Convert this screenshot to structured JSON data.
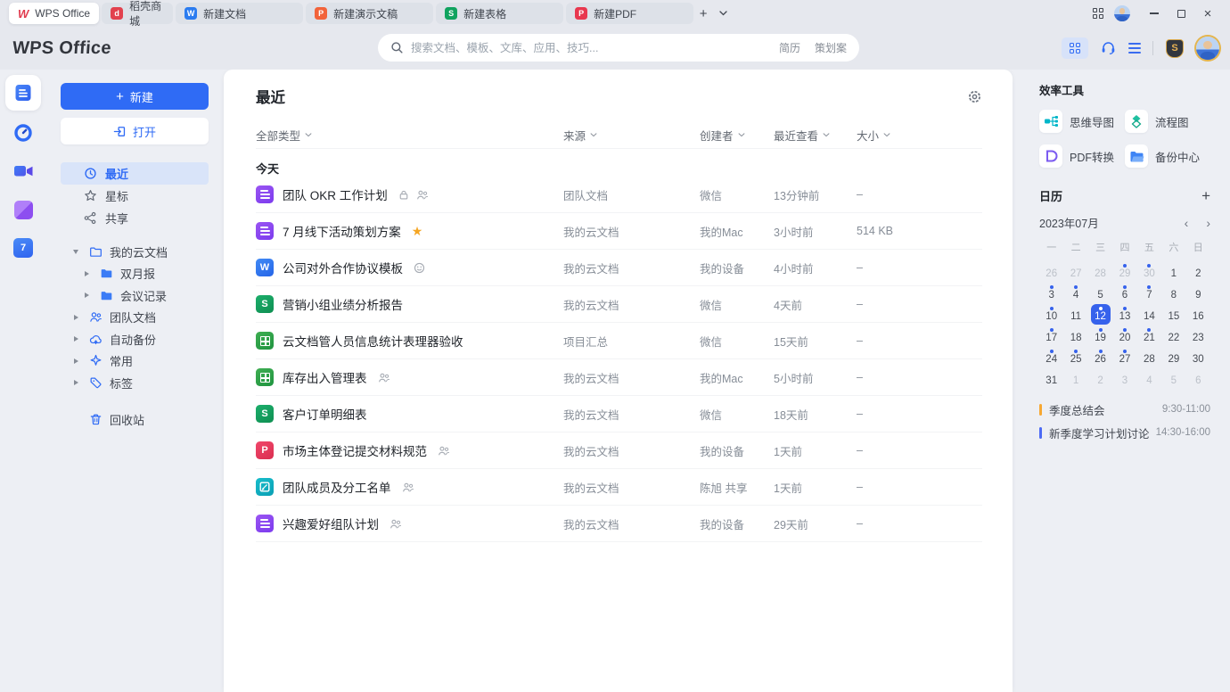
{
  "colors": {
    "accent": "#2f6bf5",
    "star": "#f5a623"
  },
  "titlebar": {
    "tabs": [
      {
        "label": "WPS Office",
        "icon": "wps-logo-icon",
        "active": true
      },
      {
        "label": "稻壳商城",
        "icon": "docer-icon",
        "color": "#e2414e",
        "letter": "d",
        "wide": false
      },
      {
        "label": "新建文档",
        "icon": "writer-icon",
        "color": "#2b7cf0",
        "letter": "W",
        "wide": true
      },
      {
        "label": "新建演示文稿",
        "icon": "presentation-icon",
        "color": "#f2633a",
        "letter": "P",
        "wide": true
      },
      {
        "label": "新建表格",
        "icon": "spreadsheet-icon",
        "color": "#10a35f",
        "letter": "S",
        "wide": true
      },
      {
        "label": "新建PDF",
        "icon": "pdf-icon",
        "color": "#e8384f",
        "letter": "P",
        "wide": true
      }
    ],
    "new_tab_label": "+"
  },
  "header": {
    "logo": "WPS Office",
    "search": {
      "placeholder": "搜索文档、模板、文库、应用、技巧...",
      "hotwords": [
        "简历",
        "策划案"
      ]
    },
    "member_badge": "S"
  },
  "rail": [
    {
      "name": "docs-home",
      "icon": "docs-icon",
      "active": true
    },
    {
      "name": "schedule",
      "icon": "clock-ring-icon",
      "active": false
    },
    {
      "name": "meeting",
      "icon": "video-camera-icon",
      "active": false
    },
    {
      "name": "apps",
      "icon": "apps-cube-icon",
      "active": false
    },
    {
      "name": "calendar",
      "icon": "calendar-7-icon",
      "label": "7",
      "active": false
    }
  ],
  "sidebar": {
    "new_button": "新建",
    "open_button": "打开",
    "nav": [
      {
        "label": "最近",
        "icon": "clock-icon",
        "active": true
      },
      {
        "label": "星标",
        "icon": "star-outline-icon",
        "active": false
      },
      {
        "label": "共享",
        "icon": "share-nodes-icon",
        "active": false
      }
    ],
    "tree": [
      {
        "label": "我的云文档",
        "icon": "folder-outline-icon",
        "caret": "down",
        "level": 0
      },
      {
        "label": "双月报",
        "icon": "folder-filled-icon",
        "caret": "right",
        "level": 1
      },
      {
        "label": "会议记录",
        "icon": "folder-filled-icon",
        "caret": "right",
        "level": 1
      },
      {
        "label": "团队文档",
        "icon": "team-icon",
        "caret": "right",
        "level": 0
      },
      {
        "label": "自动备份",
        "icon": "cloud-backup-icon",
        "caret": "right",
        "level": 0
      },
      {
        "label": "常用",
        "icon": "pin-icon",
        "caret": "right",
        "level": 0
      },
      {
        "label": "标签",
        "icon": "tag-icon",
        "caret": "right",
        "level": 0
      }
    ],
    "trash": {
      "label": "回收站",
      "icon": "trash-icon"
    }
  },
  "main": {
    "title": "最近",
    "columns": [
      "全部类型",
      "来源",
      "创建者",
      "最近查看",
      "大小"
    ],
    "group_label": "今天",
    "rows": [
      {
        "icon": "doc-purple",
        "title": "团队 OKR 工作计划",
        "badges": [
          "lock",
          "members"
        ],
        "source": "团队文档",
        "creator": "微信",
        "viewed": "13分钟前",
        "size": "–"
      },
      {
        "icon": "doc-purple",
        "title": "7 月线下活动策划方案",
        "badges": [
          "star"
        ],
        "source": "我的云文档",
        "creator": "我的Mac",
        "viewed": "3小时前",
        "size": "514 KB"
      },
      {
        "icon": "word",
        "title": "公司对外合作协议模板",
        "badges": [
          "smiley"
        ],
        "source": "我的云文档",
        "creator": "我的设备",
        "viewed": "4小时前",
        "size": "–"
      },
      {
        "icon": "sheet",
        "title": "营销小组业绩分析报告",
        "badges": [],
        "source": "我的云文档",
        "creator": "微信",
        "viewed": "4天前",
        "size": "–"
      },
      {
        "icon": "table",
        "title": "云文档管人员信息统计表理器验收",
        "badges": [],
        "source": "项目汇总",
        "creator": "微信",
        "viewed": "15天前",
        "size": "–"
      },
      {
        "icon": "table",
        "title": "库存出入管理表",
        "badges": [
          "members"
        ],
        "source": "我的云文档",
        "creator": "我的Mac",
        "viewed": "5小时前",
        "size": "–"
      },
      {
        "icon": "sheet",
        "title": "客户订单明细表",
        "badges": [],
        "source": "我的云文档",
        "creator": "微信",
        "viewed": "18天前",
        "size": "–"
      },
      {
        "icon": "pdf-link",
        "title": "市场主体登记提交材料规范",
        "badges": [
          "members"
        ],
        "source": "我的云文档",
        "creator": "我的设备",
        "viewed": "1天前",
        "size": "–"
      },
      {
        "icon": "form",
        "title": "团队成员及分工名单",
        "badges": [
          "members"
        ],
        "source": "我的云文档",
        "creator": "陈旭 共享",
        "viewed": "1天前",
        "size": "–"
      },
      {
        "icon": "doc-purple",
        "title": "兴趣爱好组队计划",
        "badges": [
          "members"
        ],
        "source": "我的云文档",
        "creator": "我的设备",
        "viewed": "29天前",
        "size": "–"
      }
    ]
  },
  "right_panel": {
    "tools_title": "效率工具",
    "tools": [
      {
        "label": "思维导图",
        "icon": "mindmap-icon"
      },
      {
        "label": "流程图",
        "icon": "flowchart-icon"
      },
      {
        "label": "PDF转换",
        "icon": "pdf-convert-icon"
      },
      {
        "label": "备份中心",
        "icon": "backup-center-icon"
      }
    ],
    "calendar": {
      "title": "日历",
      "add_label": "+",
      "month": "2023年07月",
      "prev": "‹",
      "next": "›",
      "weekdays": [
        "一",
        "二",
        "三",
        "四",
        "五",
        "六",
        "日"
      ],
      "weeks": [
        [
          {
            "d": 26,
            "muted": true
          },
          {
            "d": 27,
            "muted": true
          },
          {
            "d": 28,
            "muted": true
          },
          {
            "d": 29,
            "muted": true,
            "dot": true
          },
          {
            "d": 30,
            "muted": true,
            "dot": true
          },
          {
            "d": 1
          },
          {
            "d": 2
          }
        ],
        [
          {
            "d": 3,
            "dot": true
          },
          {
            "d": 4,
            "dot": true
          },
          {
            "d": 5
          },
          {
            "d": 6,
            "dot": true
          },
          {
            "d": 7,
            "dot": true
          },
          {
            "d": 8
          },
          {
            "d": 9
          }
        ],
        [
          {
            "d": 10,
            "dot": true
          },
          {
            "d": 11
          },
          {
            "d": 12,
            "selected": true,
            "dot": true
          },
          {
            "d": 13,
            "dot": true
          },
          {
            "d": 14
          },
          {
            "d": 15
          },
          {
            "d": 16
          }
        ],
        [
          {
            "d": 17,
            "dot": true
          },
          {
            "d": 18
          },
          {
            "d": 19,
            "dot": true
          },
          {
            "d": 20,
            "dot": true
          },
          {
            "d": 21,
            "dot": true
          },
          {
            "d": 22
          },
          {
            "d": 23
          }
        ],
        [
          {
            "d": 24,
            "dot": true
          },
          {
            "d": 25,
            "dot": true
          },
          {
            "d": 26,
            "dot": true
          },
          {
            "d": 27,
            "dot": true
          },
          {
            "d": 28
          },
          {
            "d": 29
          },
          {
            "d": 30
          }
        ],
        [
          {
            "d": 31
          },
          {
            "d": 1,
            "muted": true
          },
          {
            "d": 2,
            "muted": true
          },
          {
            "d": 3,
            "muted": true
          },
          {
            "d": 4,
            "muted": true
          },
          {
            "d": 5,
            "muted": true
          },
          {
            "d": 6,
            "muted": true
          }
        ]
      ]
    },
    "events": [
      {
        "title": "季度总结会",
        "time": "9:30-11:00",
        "color": "#f7a832"
      },
      {
        "title": "新季度学习计划讨论",
        "time": "14:30-16:00",
        "color": "#4c6af5"
      }
    ]
  }
}
